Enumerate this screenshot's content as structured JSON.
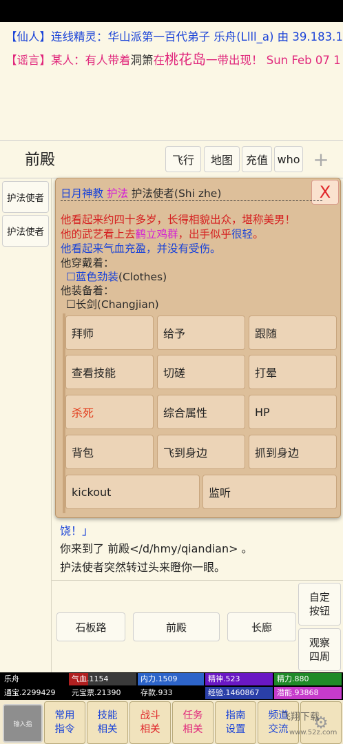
{
  "messages": [
    {
      "tag": "【仙人】",
      "text": "连线精灵：华山派第一百代弟子 乐舟(Llll_a) 由 39.183.1"
    },
    {
      "tag": "【谣言】",
      "text_a": "某人：有人带着",
      "item": "洞箫",
      "text_b": "在",
      "place": "桃花岛",
      "text_c": "一带出现！ Sun Feb 07 1"
    }
  ],
  "header": {
    "room": "前殿",
    "buttons": [
      "飞行",
      "地图",
      "充值",
      "who"
    ],
    "plus": "+"
  },
  "npcs": [
    "护法使者",
    "护法使者"
  ],
  "popup": {
    "faction": "日月神教",
    "rank": "护法",
    "name": "护法使者(Shi zhe)",
    "close": "X",
    "divider": "——————————————————————————",
    "desc1": "他看起来约四十多岁，长得相貌出众，堪称美男！",
    "desc2_a": "他的武艺看上去",
    "desc2_skill": "鹤立鸡群",
    "desc2_b": "，出手似乎",
    "desc2_c": "很轻",
    "desc2_d": "。",
    "desc3": "他看起来气血充盈，并没有受伤。",
    "wear_label": "他穿戴着：",
    "wear_box": "☐",
    "wear_item": "蓝色劲装",
    "wear_en": "(Clothes)",
    "equip_label": "他装备着：",
    "equip_item": "☐长剑(Changjian)",
    "actions": [
      "拜师",
      "给予",
      "跟随",
      "查看技能",
      "切磋",
      "打晕",
      "杀死",
      "综合属性",
      "HP",
      "背包",
      "飞到身边",
      "抓到身边",
      "kickout",
      "监听"
    ]
  },
  "log": [
    "饶！」",
    "你来到了 前殿</d/hmy/qiandian> 。",
    "护法使者突然转过头来瞪你一眼。"
  ],
  "exits": [
    "石板路",
    "前殿",
    "长廊"
  ],
  "side_buttons": [
    {
      "l1": "自定",
      "l2": "按钮"
    },
    {
      "l1": "观察",
      "l2": "四周"
    }
  ],
  "stats": {
    "name": "乐舟",
    "qixue": "气血.1154",
    "neili": "内力.1509",
    "jingshen": "精神.523",
    "jingli": "精力.880",
    "tongbao": "通宝.2299429",
    "yuanbao": "元宝票.21390",
    "cunkuan": "存款.933",
    "jingyan": "经验.1460867",
    "qianneng": "潜能.93868"
  },
  "nav": {
    "input": "输入指",
    "buttons": [
      {
        "l1": "常用",
        "l2": "指令"
      },
      {
        "l1": "技能",
        "l2": "相关"
      },
      {
        "l1": "战斗",
        "l2": "相关"
      },
      {
        "l1": "任务",
        "l2": "相关"
      },
      {
        "l1": "指南",
        "l2": "设置"
      },
      {
        "l1": "频道",
        "l2": "交流"
      }
    ]
  },
  "watermark": {
    "main": "飞翔下载",
    "sub": "www.52z.com"
  },
  "colors": {
    "accent_blue": "#1a43d8",
    "rumor_pink": "#e0267b",
    "popup_bg": "#ddbf9a",
    "kill_red": "#e23a1a"
  }
}
